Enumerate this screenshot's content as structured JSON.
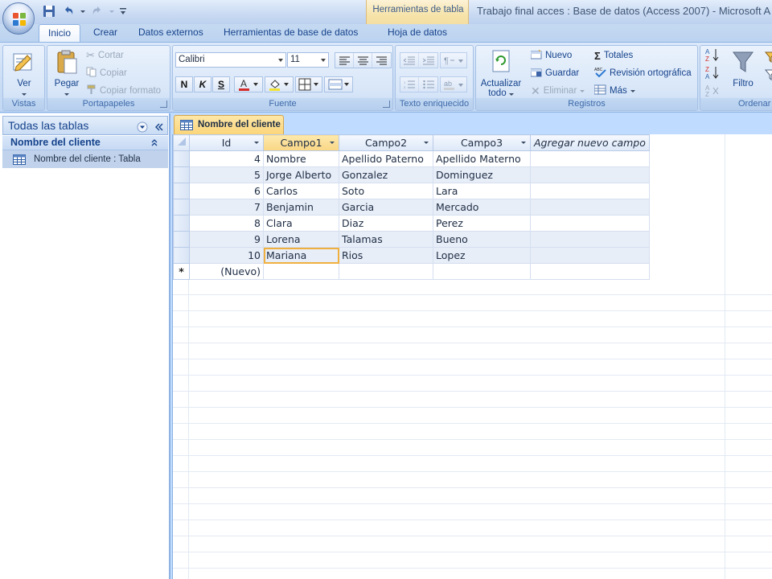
{
  "window": {
    "title": "Trabajo final acces : Base de datos (Access 2007) - Microsoft A",
    "contextual_group": "Herramientas de tabla"
  },
  "ribbon_tabs": [
    "Inicio",
    "Crear",
    "Datos externos",
    "Herramientas de base de datos",
    "Hoja de datos"
  ],
  "active_tab": "Inicio",
  "groups": {
    "vistas": {
      "label": "Vistas",
      "ver": "Ver"
    },
    "portapapeles": {
      "label": "Portapapeles",
      "pegar": "Pegar",
      "cortar": "Cortar",
      "copiar": "Copiar",
      "copiar_formato": "Copiar formato"
    },
    "fuente": {
      "label": "Fuente",
      "font_name": "Calibri",
      "font_size": "11",
      "bold": "N",
      "italic": "K",
      "underline": "S"
    },
    "texto_enriquecido": {
      "label": "Texto enriquecido"
    },
    "registros": {
      "label": "Registros",
      "actualizar_line1": "Actualizar",
      "actualizar_line2": "todo",
      "nuevo": "Nuevo",
      "guardar": "Guardar",
      "eliminar": "Eliminar",
      "totales": "Totales",
      "revision": "Revisión ortográfica",
      "mas": "Más"
    },
    "ordenar": {
      "label": "Ordenar",
      "filtro": "Filtro"
    }
  },
  "nav_pane": {
    "header": "Todas las tablas",
    "group": "Nombre del cliente",
    "item": "Nombre del cliente : Tabla"
  },
  "document_tab": "Nombre del cliente",
  "datasheet": {
    "columns": [
      "Id",
      "Campo1",
      "Campo2",
      "Campo3",
      "Agregar nuevo campo"
    ],
    "rows": [
      [
        "4",
        "Nombre",
        "Apellido Paterno",
        "Apellido Materno"
      ],
      [
        "5",
        "Jorge Alberto",
        "Gonzalez",
        "Dominguez"
      ],
      [
        "6",
        "Carlos",
        "Soto",
        "Lara"
      ],
      [
        "7",
        "Benjamin",
        "Garcia",
        "Mercado"
      ],
      [
        "8",
        "Clara",
        "Diaz",
        "Perez"
      ],
      [
        "9",
        "Lorena",
        "Talamas",
        "Bueno"
      ],
      [
        "10",
        "Mariana",
        "Rios",
        "Lopez"
      ]
    ],
    "new_row_label": "(Nuevo)",
    "new_row_marker": "*"
  },
  "colors": {
    "ribbon_bg": "#c7dbf4",
    "contextual": "#f6e2a6",
    "selection": "#fbd57a",
    "text": "#15428b"
  }
}
